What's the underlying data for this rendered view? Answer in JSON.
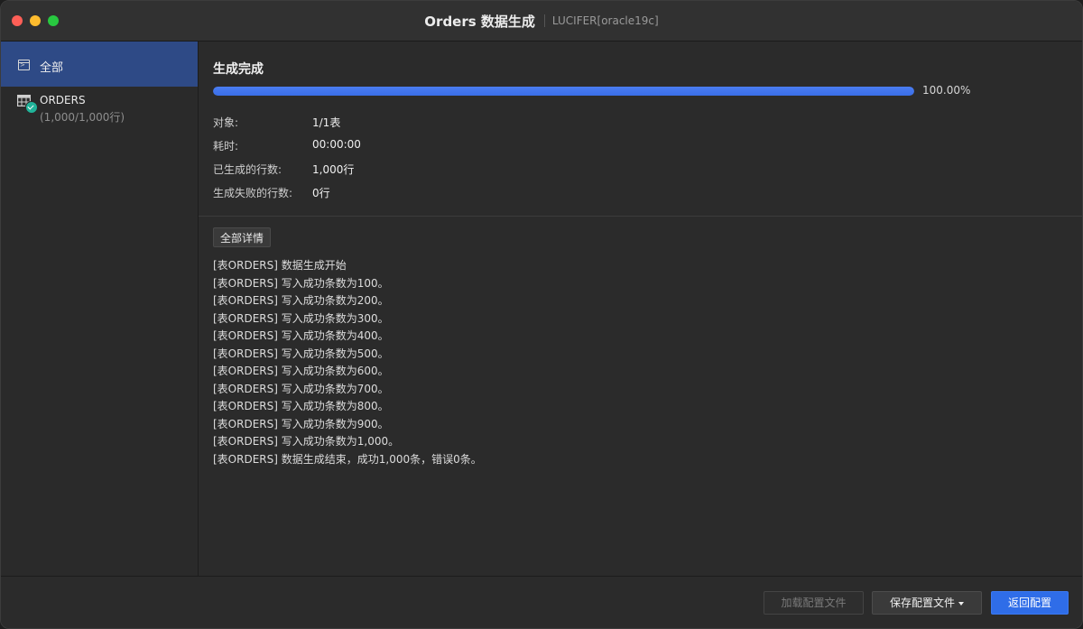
{
  "window": {
    "title": "Orders 数据生成",
    "connection": "LUCIFER[oracle19c]"
  },
  "sidebar": {
    "all_label": "全部",
    "table": {
      "name": "ORDERS",
      "count": "(1,000/1,000行)"
    }
  },
  "status": {
    "title": "生成完成",
    "progress": 1.0,
    "progress_text": "100.00%",
    "stats": [
      {
        "label": "对象:",
        "value": "1/1表"
      },
      {
        "label": "耗时:",
        "value": "00:00:00"
      },
      {
        "label": "已生成的行数:",
        "value": "1,000行"
      },
      {
        "label": "生成失败的行数:",
        "value": "0行"
      }
    ]
  },
  "details": {
    "button_label": "全部详情",
    "log": [
      "[表ORDERS] 数据生成开始",
      "[表ORDERS] 写入成功条数为100。",
      "[表ORDERS] 写入成功条数为200。",
      "[表ORDERS] 写入成功条数为300。",
      "[表ORDERS] 写入成功条数为400。",
      "[表ORDERS] 写入成功条数为500。",
      "[表ORDERS] 写入成功条数为600。",
      "[表ORDERS] 写入成功条数为700。",
      "[表ORDERS] 写入成功条数为800。",
      "[表ORDERS] 写入成功条数为900。",
      "[表ORDERS] 写入成功条数为1,000。",
      "[表ORDERS] 数据生成结束，成功1,000条，错误0条。"
    ]
  },
  "footer": {
    "load_label": "加载配置文件",
    "save_label": "保存配置文件",
    "back_label": "返回配置"
  },
  "colors": {
    "accent": "#2f6de8",
    "selected": "#2e4a86",
    "success": "#20b49a"
  }
}
